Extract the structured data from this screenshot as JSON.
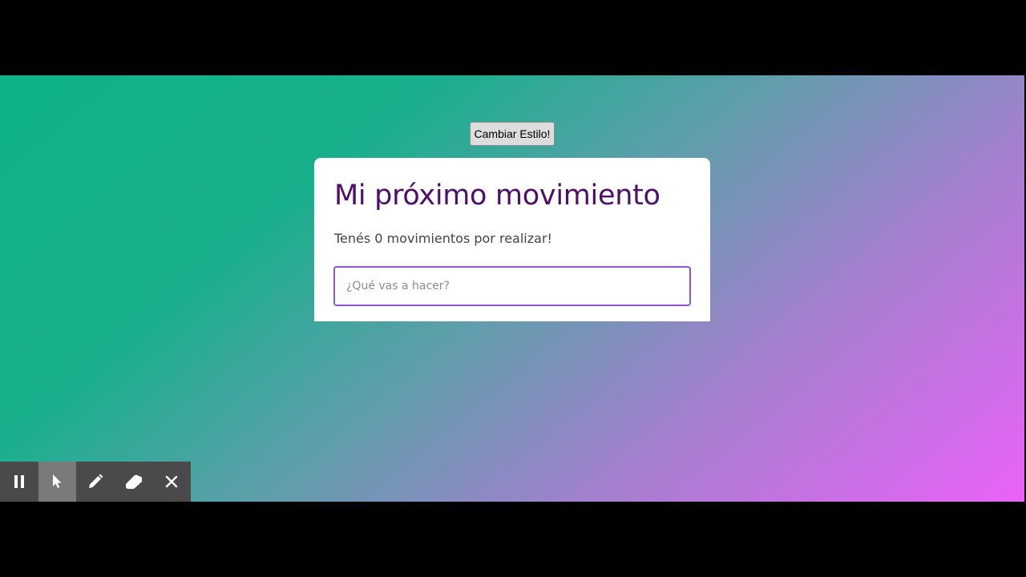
{
  "style_button": {
    "label": "Cambiar Estilo!"
  },
  "card": {
    "title": "Mi próximo movimiento",
    "subtitle": "Tenés 0 movimientos por realizar!",
    "input": {
      "placeholder": "¿Qué vas a hacer?",
      "value": ""
    }
  },
  "toolbar": {
    "items": [
      {
        "icon": "pause-icon",
        "active": false
      },
      {
        "icon": "cursor-icon",
        "active": true
      },
      {
        "icon": "pencil-icon",
        "active": false
      },
      {
        "icon": "eraser-icon",
        "active": false
      },
      {
        "icon": "close-icon",
        "active": false
      }
    ]
  },
  "colors": {
    "gradient_start": "#0fb389",
    "gradient_end": "#ea62f8",
    "title": "#4e0f6a",
    "input_border": "#8a55d8",
    "toolbar_bg": "#4a4a4a"
  }
}
